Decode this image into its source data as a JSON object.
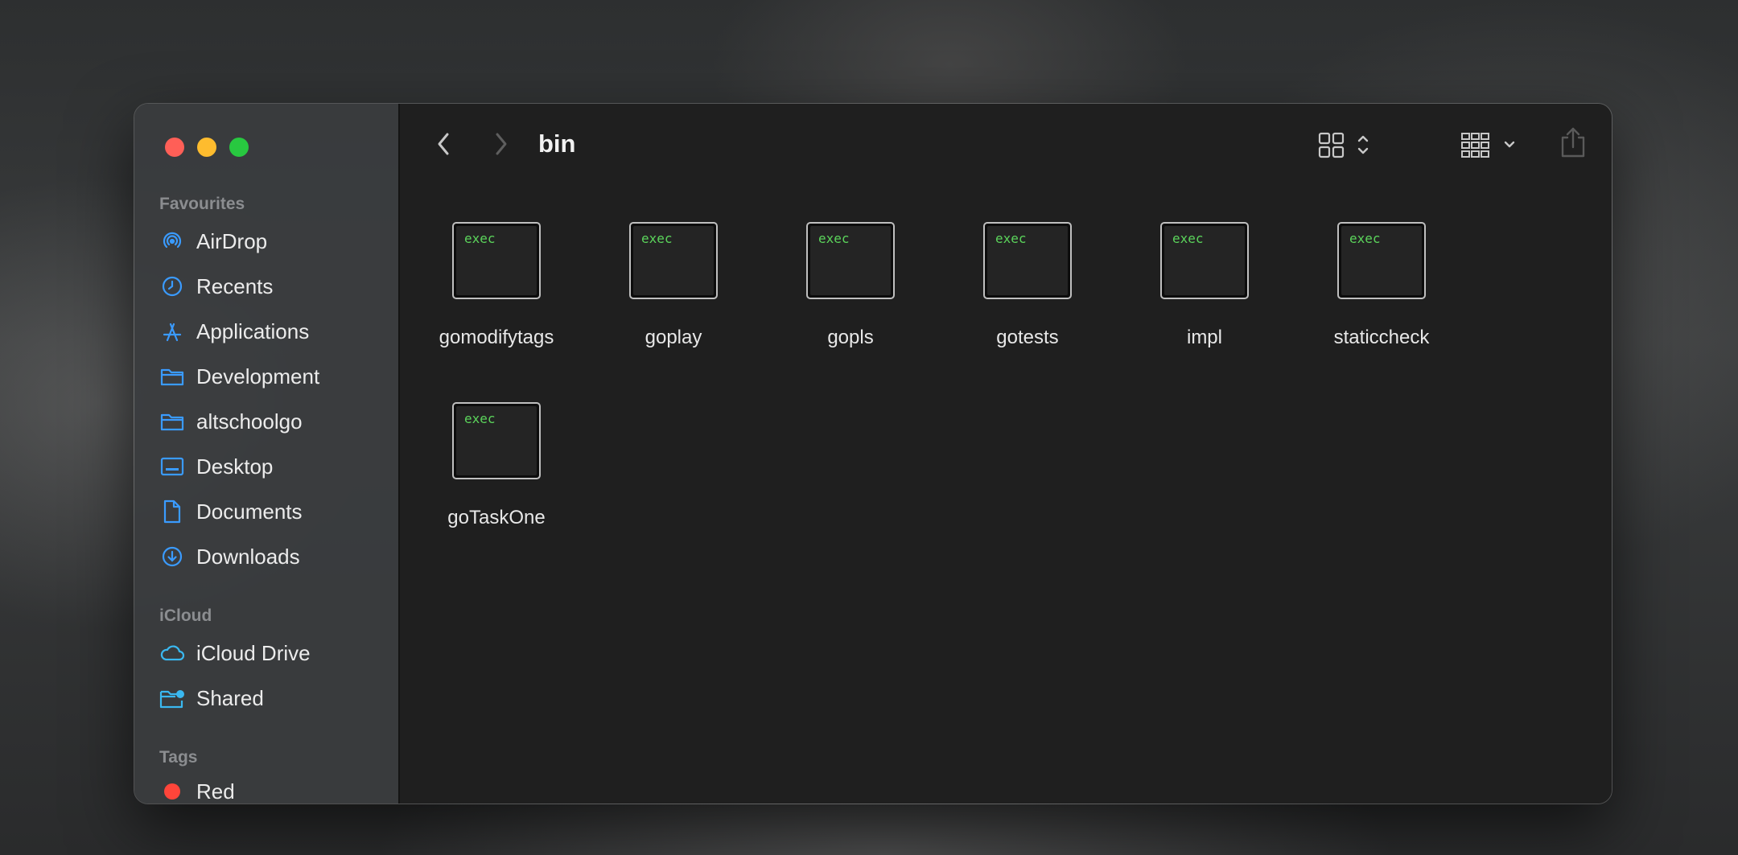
{
  "window": {
    "title": "bin"
  },
  "sidebar": {
    "favourites_title": "Favourites",
    "favourites": [
      {
        "label": "AirDrop",
        "icon": "airdrop-icon"
      },
      {
        "label": "Recents",
        "icon": "clock-icon"
      },
      {
        "label": "Applications",
        "icon": "applications-icon"
      },
      {
        "label": "Development",
        "icon": "folder-icon"
      },
      {
        "label": "altschoolgo",
        "icon": "folder-icon"
      },
      {
        "label": "Desktop",
        "icon": "desktop-icon"
      },
      {
        "label": "Documents",
        "icon": "document-icon"
      },
      {
        "label": "Downloads",
        "icon": "download-icon"
      }
    ],
    "icloud_title": "iCloud",
    "icloud": [
      {
        "label": "iCloud Drive",
        "icon": "cloud-icon"
      },
      {
        "label": "Shared",
        "icon": "shared-folder-icon"
      }
    ],
    "tags_title": "Tags",
    "tags": [
      {
        "label": "Red",
        "color": "#ff453a"
      }
    ]
  },
  "files": [
    {
      "name": "gomodifytags",
      "badge": "exec"
    },
    {
      "name": "goplay",
      "badge": "exec"
    },
    {
      "name": "gopls",
      "badge": "exec"
    },
    {
      "name": "gotests",
      "badge": "exec"
    },
    {
      "name": "impl",
      "badge": "exec"
    },
    {
      "name": "staticcheck",
      "badge": "exec"
    },
    {
      "name": "goTaskOne",
      "badge": "exec"
    }
  ],
  "colors": {
    "accent": "#0a84ff",
    "exec_text": "#5bd45b"
  }
}
